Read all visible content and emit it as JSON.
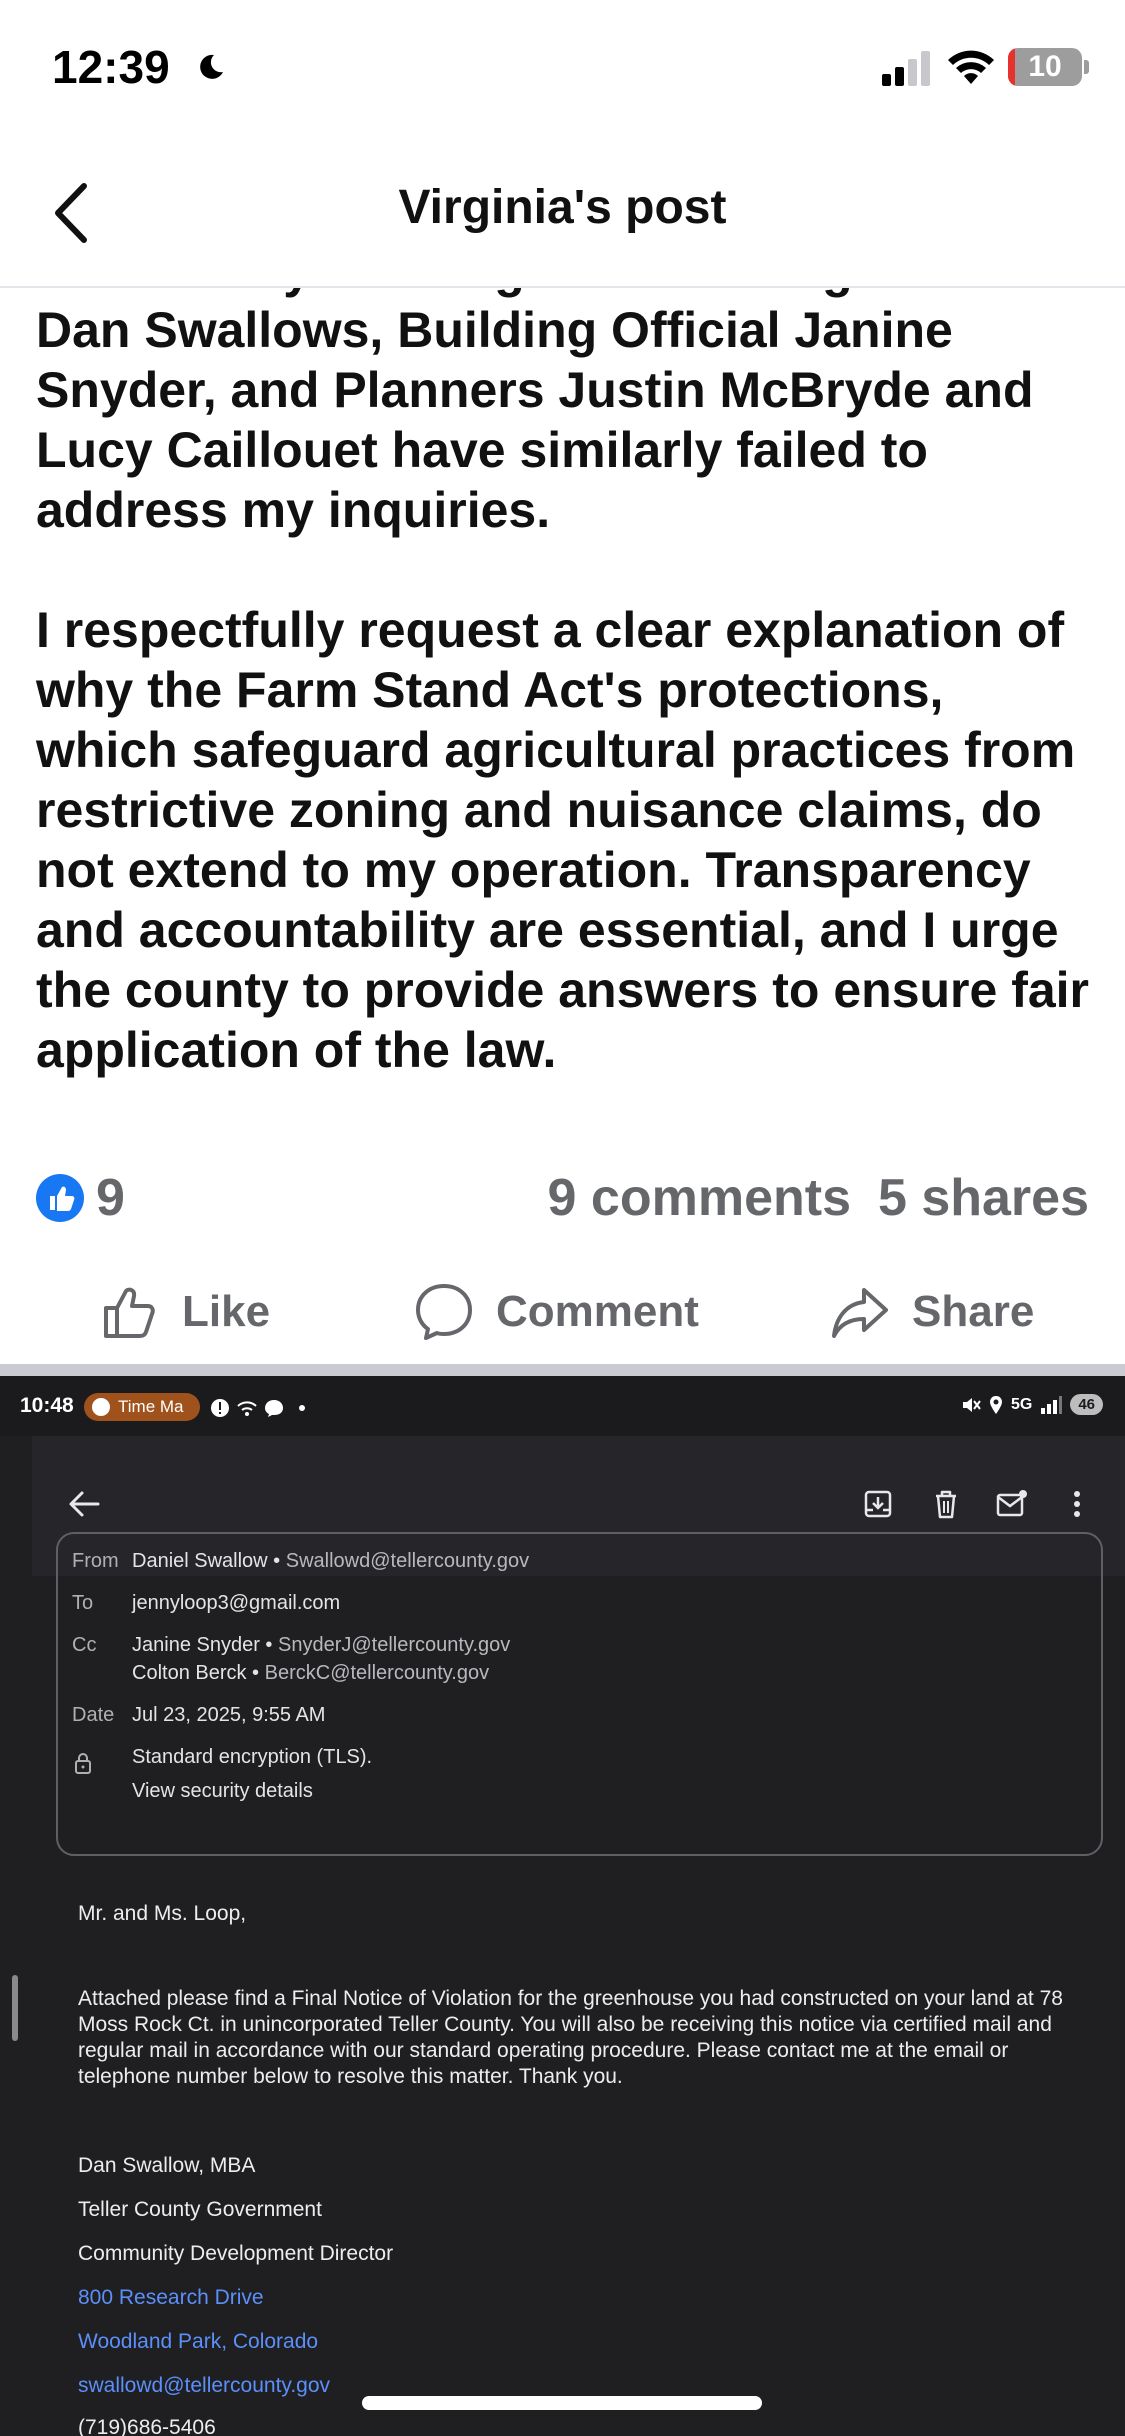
{
  "status_bar": {
    "time": "12:39",
    "battery": "10",
    "battery_level": 0.1,
    "icons": [
      "moon-icon",
      "signal-icon",
      "wifi-icon",
      "battery-icon"
    ]
  },
  "header": {
    "title": "Virginia's post",
    "back_icon": "chevron-left-icon"
  },
  "post": {
    "paragraphs": [
      "Community Building and Planning Director Dan Swallows, Building Official Janine Snyder, and Planners Justin McBryde and Lucy Caillouet have similarly failed to address my inquiries.",
      "I respectfully request a clear explanation of why the Farm Stand Act's protections, which safeguard agricultural practices from restrictive zoning and nuisance claims, do not extend to my operation. Transparency and accountability are essential, and I urge the county to provide answers to ensure fair application of the law."
    ],
    "reaction_count": "9",
    "comments": "9 comments",
    "shares": "5 shares",
    "actions": {
      "like": "Like",
      "comment": "Comment",
      "share": "Share"
    },
    "colors": {
      "like_blue": "#1877f2",
      "meta_gray": "#65676b"
    }
  },
  "embedded": {
    "status": {
      "time": "10:48",
      "pill": "Time Ma",
      "network": "5G",
      "battery": "46"
    },
    "email": {
      "from_label": "From",
      "from_name": "Daniel Swallow",
      "from_addr": "Swallowd@tellercounty.gov",
      "to_label": "To",
      "to_addr": "jennyloop3@gmail.com",
      "cc_label": "Cc",
      "cc": [
        {
          "name": "Janine Snyder",
          "addr": "SnyderJ@tellercounty.gov"
        },
        {
          "name": "Colton Berck",
          "addr": "BerckC@tellercounty.gov"
        }
      ],
      "date_label": "Date",
      "date": "Jul 23, 2025, 9:55 AM",
      "encryption": "Standard encryption (TLS).",
      "security_link": "View security details",
      "greeting": "Mr. and Ms. Loop,",
      "body": "Attached please find a Final Notice of Violation for the greenhouse you had constructed on your land at 78 Moss Rock Ct. in unincorporated Teller County.  You will also be receiving this notice via certified mail and regular mail in accordance with our standard operating procedure.  Please contact me at the email or telephone number below to resolve this matter.  Thank you.",
      "signature": {
        "name": "Dan Swallow, MBA",
        "org": "Teller County Government",
        "role": "Community Development Director",
        "street": "800 Research Drive",
        "city": "Woodland Park, Colorado",
        "email": "swallowd@tellercounty.gov",
        "phone": "(719)686-5406"
      }
    }
  }
}
